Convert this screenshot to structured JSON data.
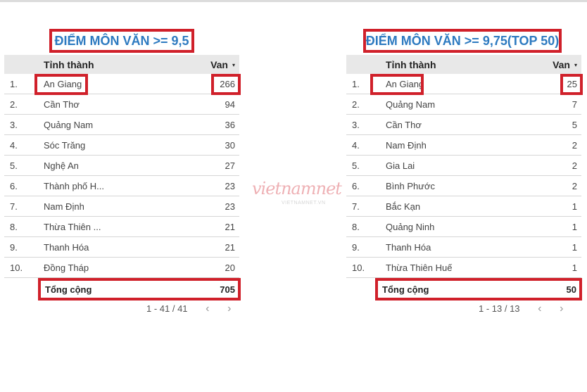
{
  "watermark": {
    "brand": "vietnamnet",
    "url": "VIETNAMNET.VN"
  },
  "tables": [
    {
      "title": "ĐIỂM MÔN VĂN >= 9,5",
      "header": {
        "name_col": "Tỉnh thành",
        "value_col": "Van",
        "sort_icon": "▾"
      },
      "rows": [
        {
          "rank": "1.",
          "name": "An Giang",
          "value": "266"
        },
        {
          "rank": "2.",
          "name": "Cần Thơ",
          "value": "94"
        },
        {
          "rank": "3.",
          "name": "Quảng Nam",
          "value": "36"
        },
        {
          "rank": "4.",
          "name": "Sóc Trăng",
          "value": "30"
        },
        {
          "rank": "5.",
          "name": "Nghệ An",
          "value": "27"
        },
        {
          "rank": "6.",
          "name": "Thành phố H...",
          "value": "23"
        },
        {
          "rank": "7.",
          "name": "Nam Định",
          "value": "23"
        },
        {
          "rank": "8.",
          "name": "Thừa Thiên ...",
          "value": "21"
        },
        {
          "rank": "9.",
          "name": "Thanh Hóa",
          "value": "21"
        },
        {
          "rank": "10.",
          "name": "Đồng Tháp",
          "value": "20"
        }
      ],
      "total": {
        "label": "Tổng cộng",
        "value": "705"
      },
      "pagination": {
        "text": "1 - 41 / 41",
        "prev": "‹",
        "next": "›"
      }
    },
    {
      "title": "ĐIỂM MÔN VĂN >= 9,75(TOP 50)",
      "header": {
        "name_col": "Tỉnh thành",
        "value_col": "Van",
        "sort_icon": "▾"
      },
      "rows": [
        {
          "rank": "1.",
          "name": "An Giang",
          "value": "25"
        },
        {
          "rank": "2.",
          "name": "Quảng Nam",
          "value": "7"
        },
        {
          "rank": "3.",
          "name": "Cần Thơ",
          "value": "5"
        },
        {
          "rank": "4.",
          "name": "Nam Định",
          "value": "2"
        },
        {
          "rank": "5.",
          "name": "Gia Lai",
          "value": "2"
        },
        {
          "rank": "6.",
          "name": "Bình Phước",
          "value": "2"
        },
        {
          "rank": "7.",
          "name": "Bắc Kạn",
          "value": "1"
        },
        {
          "rank": "8.",
          "name": "Quảng Ninh",
          "value": "1"
        },
        {
          "rank": "9.",
          "name": "Thanh Hóa",
          "value": "1"
        },
        {
          "rank": "10.",
          "name": "Thừa Thiên Huế",
          "value": "1"
        }
      ],
      "total": {
        "label": "Tổng cộng",
        "value": "50"
      },
      "pagination": {
        "text": "1 - 13 / 13",
        "prev": "‹",
        "next": "›"
      }
    }
  ]
}
